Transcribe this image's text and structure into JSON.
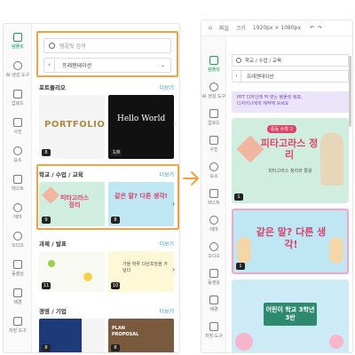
{
  "left_panel": {
    "rail": [
      {
        "label": "템플릿",
        "icon": "template-icon",
        "active": true
      },
      {
        "label": "AI 생성 도구",
        "icon": "ai-tools-icon"
      },
      {
        "label": "업로드",
        "icon": "upload-icon"
      },
      {
        "label": "사진",
        "icon": "photo-icon"
      },
      {
        "label": "요소",
        "icon": "elements-icon"
      },
      {
        "label": "텍스트",
        "icon": "text-icon"
      },
      {
        "label": "테마",
        "icon": "theme-icon"
      },
      {
        "label": "오디오",
        "icon": "audio-icon"
      },
      {
        "label": "동영상",
        "icon": "video-icon"
      },
      {
        "label": "배경",
        "icon": "background-icon"
      },
      {
        "label": "저장 도구",
        "icon": "save-tools-icon"
      }
    ],
    "search_placeholder": "템플릿 검색",
    "category_value": "프레젠테이션",
    "sections": [
      {
        "title": "포트폴리오",
        "more": "더보기",
        "badges": [
          "8",
          "1/8"
        ],
        "thumb_texts": [
          "PORTFOLIO",
          "Hello World"
        ]
      },
      {
        "title": "학교 / 수업 / 교육",
        "more": "더보기",
        "badges": [
          "9",
          "8"
        ],
        "thumb_texts": [
          "피타고라스 정리",
          "같은 말? 다른 생각!"
        ]
      },
      {
        "title": "과제 / 발표",
        "more": "더보기",
        "badges": [
          "11",
          "10"
        ],
        "thumb_texts": [
          "",
          "가을 하루 다산초당을 거닐다"
        ]
      },
      {
        "title": "경영 / 기업",
        "more": "더보기",
        "badges": [
          "8",
          "8"
        ],
        "thumb_texts": [
          "",
          "PLAN PROPOSAL"
        ]
      }
    ]
  },
  "right_panel": {
    "topbar": [
      "파일",
      "크기",
      "1920px × 1080px"
    ],
    "rail": [
      {
        "label": "템플릿",
        "icon": "template-icon",
        "active": true
      },
      {
        "label": "AI 생성 도구",
        "icon": "ai-tools-icon"
      },
      {
        "label": "업로드",
        "icon": "upload-icon"
      },
      {
        "label": "사진",
        "icon": "photo-icon"
      },
      {
        "label": "요소",
        "icon": "elements-icon"
      },
      {
        "label": "텍스트",
        "icon": "text-icon"
      },
      {
        "label": "테마",
        "icon": "theme-icon"
      },
      {
        "label": "오디오",
        "icon": "audio-icon"
      },
      {
        "label": "동영상",
        "icon": "video-icon"
      },
      {
        "label": "배경",
        "icon": "background-icon"
      },
      {
        "label": "저장 도구",
        "icon": "save-tools-icon"
      }
    ],
    "search_value": "학교 / 수업 / 교육",
    "category_value": "프레젠테이션",
    "promo_line1": "PPT 디자인에 딱 맞는 템플릿 배포,",
    "promo_line2": "디자이너에게 제작해 보세요",
    "cards": [
      {
        "kicker": "중등 수학 2",
        "title": "피타고라스 정리",
        "sub": "피타고라스 정리와 활용",
        "badge": "1"
      },
      {
        "kicker": "",
        "title": "같은 말? 다른 생각!",
        "sub": "",
        "badge": "1"
      },
      {
        "kicker": "",
        "title": "어린이 학교 3학년 3반",
        "sub": "",
        "badge": ""
      }
    ]
  },
  "colors": {
    "highlight": "#f2a43a",
    "accent": "#18a058",
    "link": "#3aa0c8"
  }
}
